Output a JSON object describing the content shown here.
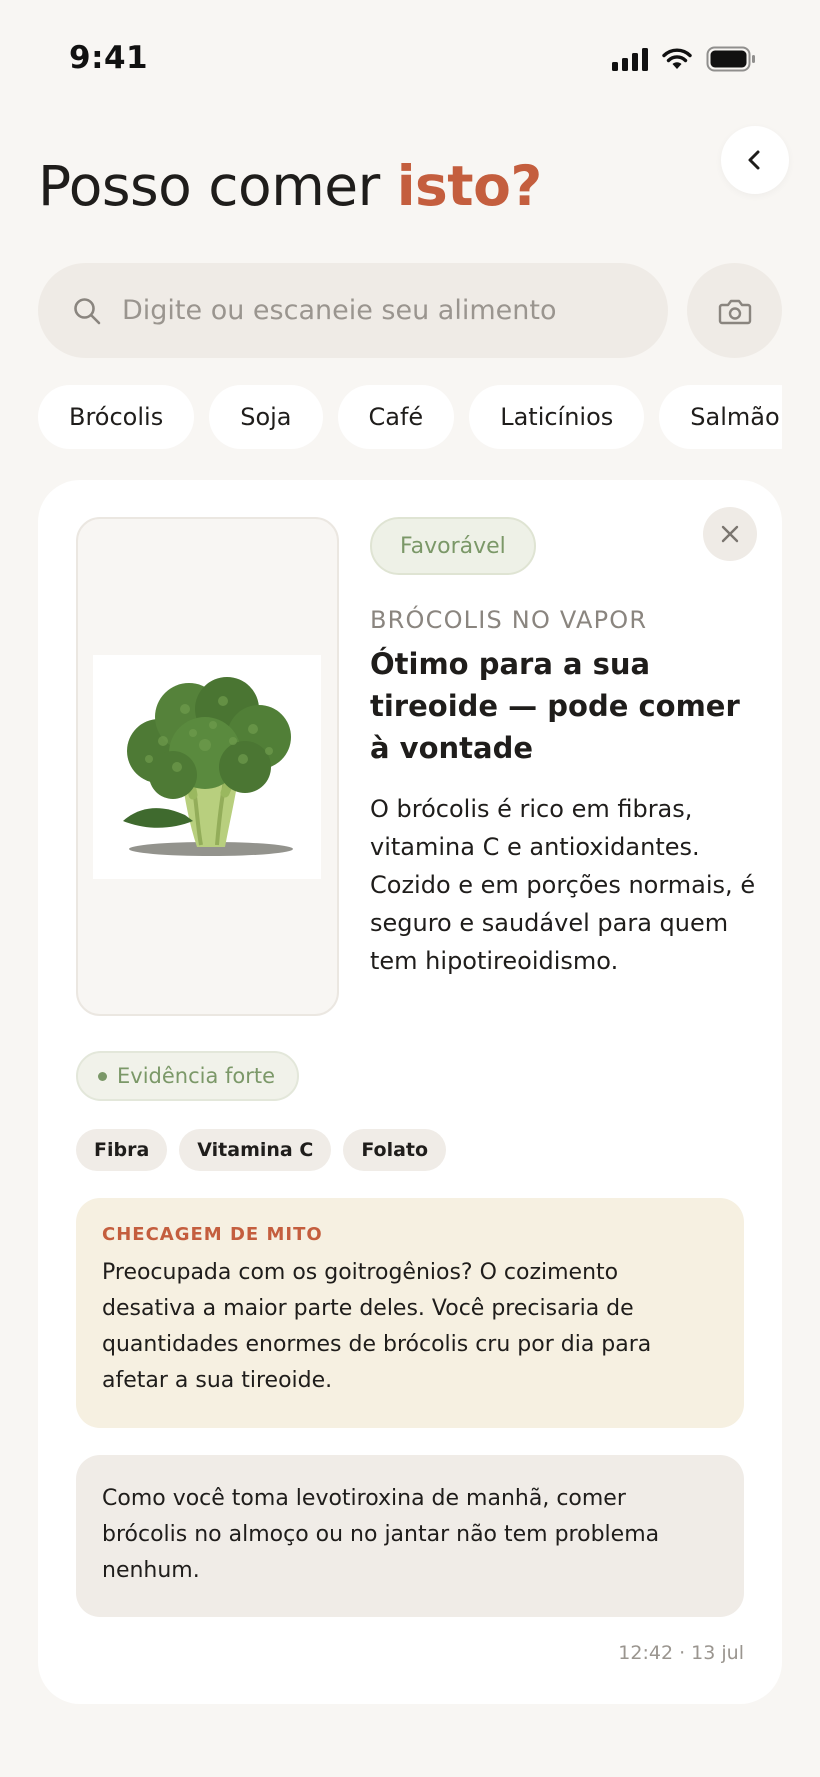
{
  "status_bar": {
    "time": "9:41",
    "icons": [
      "signal-icon",
      "wifi-icon",
      "battery-icon"
    ]
  },
  "header": {
    "title_main": "Posso comer ",
    "title_accent": "isto?",
    "back_icon": "chevron-left-icon"
  },
  "search": {
    "placeholder": "Digite ou escaneie seu alimento",
    "value": "",
    "search_icon": "search-icon",
    "camera_icon": "camera-icon"
  },
  "quick_chips": [
    "Brócolis",
    "Soja",
    "Café",
    "Laticínios",
    "Salmão"
  ],
  "result": {
    "verdict": "Favorável",
    "food_name": "BRÓCOLIS NO VAPOR",
    "headline": "Ótimo para a sua tireoide — pode comer à vontade",
    "description": "O brócolis é rico em fibras, vitamina C e antioxidantes. Cozido e em porções normais, é seguro e saudável para quem tem hipotireoidismo.",
    "evidence": "Evidência forte",
    "nutrients": [
      "Fibra",
      "Vitamina C",
      "Folato"
    ],
    "myth_label": "CHECAGEM DE MITO",
    "myth_text": "Preocupada com os goitrogênios? O cozimento desativa a maior parte deles. Você precisaria de quantidades enormes de brócolis cru por dia para afetar a sua tireoide.",
    "personal_note": "Como você toma levotiroxina de manhã, comer brócolis no almoço ou no jantar não tem problema nenhum.",
    "timestamp": "12:42 · 13 jul"
  },
  "colors": {
    "accent": "#c45e3e",
    "favorable_green": "#7b9868",
    "background": "#f8f6f3",
    "myth_bg": "#f6f0e1"
  }
}
